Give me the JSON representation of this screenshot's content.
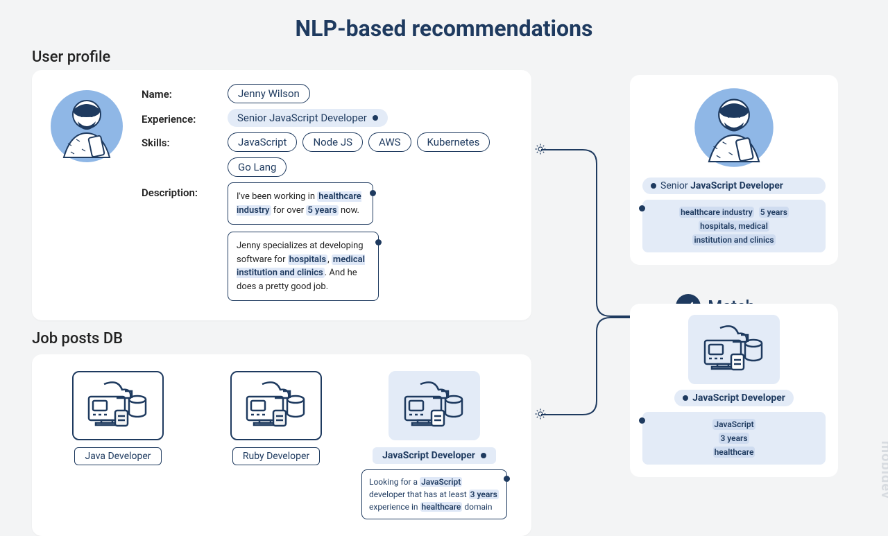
{
  "title": "NLP-based recommendations",
  "sections": {
    "profile": "User profile",
    "jobs": "Job posts DB"
  },
  "profile": {
    "labels": {
      "name": "Name:",
      "experience": "Experience:",
      "skills": "Skills:",
      "description": "Description:"
    },
    "name": "Jenny Wilson",
    "experience": "Senior JavaScript Developer",
    "skills": [
      "JavaScript",
      "Node JS",
      "AWS",
      "Kubernetes",
      "Go Lang"
    ],
    "desc1_pre": "I've been working in ",
    "desc1_hl1": "healthcare industry",
    "desc1_mid": " for over ",
    "desc1_hl2": "5 years",
    "desc1_post": " now.",
    "desc2_pre": "Jenny specializes at developing software for ",
    "desc2_hl1": "hospitals",
    "desc2_sep1": ", ",
    "desc2_hl2": "medical institution and clinics",
    "desc2_post": ". And he does a pretty good job."
  },
  "jobs": [
    {
      "title": "Java Developer"
    },
    {
      "title": "Ruby Developer"
    },
    {
      "title": "JavaScript Developer",
      "desc_pre": "Looking for a ",
      "desc_hl1": "JavaScript",
      "desc_mid1": " developer that has at least ",
      "desc_hl2": "3 years",
      "desc_mid2": " experience in ",
      "desc_hl3": "healthcare",
      "desc_post": " domain"
    }
  ],
  "extracted_profile": {
    "title_pre": "Senior ",
    "title_bold": "JavaScript Developer",
    "tags": [
      "healthcare industry",
      "5 years",
      "hospitals, medical",
      "institution and clinics"
    ]
  },
  "extracted_job": {
    "title": "JavaScript Developer",
    "tags": [
      "JavaScript",
      "3 years",
      "healthcare"
    ]
  },
  "match_label": "Match",
  "watermark": "mobidev"
}
